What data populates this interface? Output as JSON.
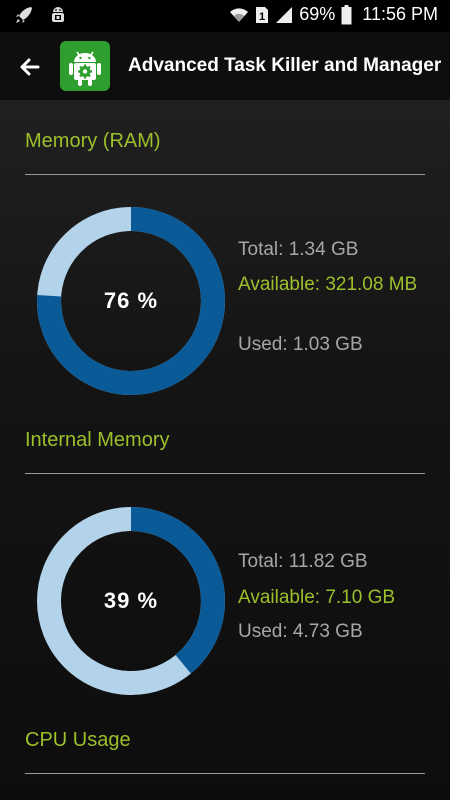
{
  "status_bar": {
    "battery": "69%",
    "time": "11:56 PM",
    "left_icons": [
      "rocket-icon",
      "android-debug-icon"
    ],
    "right_icons": [
      "wifi-icon",
      "sim-icon",
      "signal-icon",
      "battery-icon"
    ]
  },
  "app_bar": {
    "title": "Advanced Task Killer and Manager",
    "back_icon": "arrow-left-icon",
    "app_icon": "android-gear-icon"
  },
  "colors": {
    "accent": "#9cbf2c",
    "ring_used": "#0a5a98",
    "ring_free": "#b3d3ea",
    "background": "#0d0d0d"
  },
  "sections": {
    "ram": {
      "title": "Memory (RAM)",
      "percent_label": "76 %",
      "percent_value": 0.76,
      "total": "Total: 1.34 GB",
      "available": "Available: 321.08 MB",
      "used": "Used: 1.03 GB"
    },
    "internal": {
      "title": "Internal Memory",
      "percent_label": "39 %",
      "percent_value": 0.39,
      "total": "Total: 11.82 GB",
      "available": "Available: 7.10 GB",
      "used": "Used: 4.73 GB"
    },
    "cpu": {
      "title": "CPU Usage"
    }
  }
}
